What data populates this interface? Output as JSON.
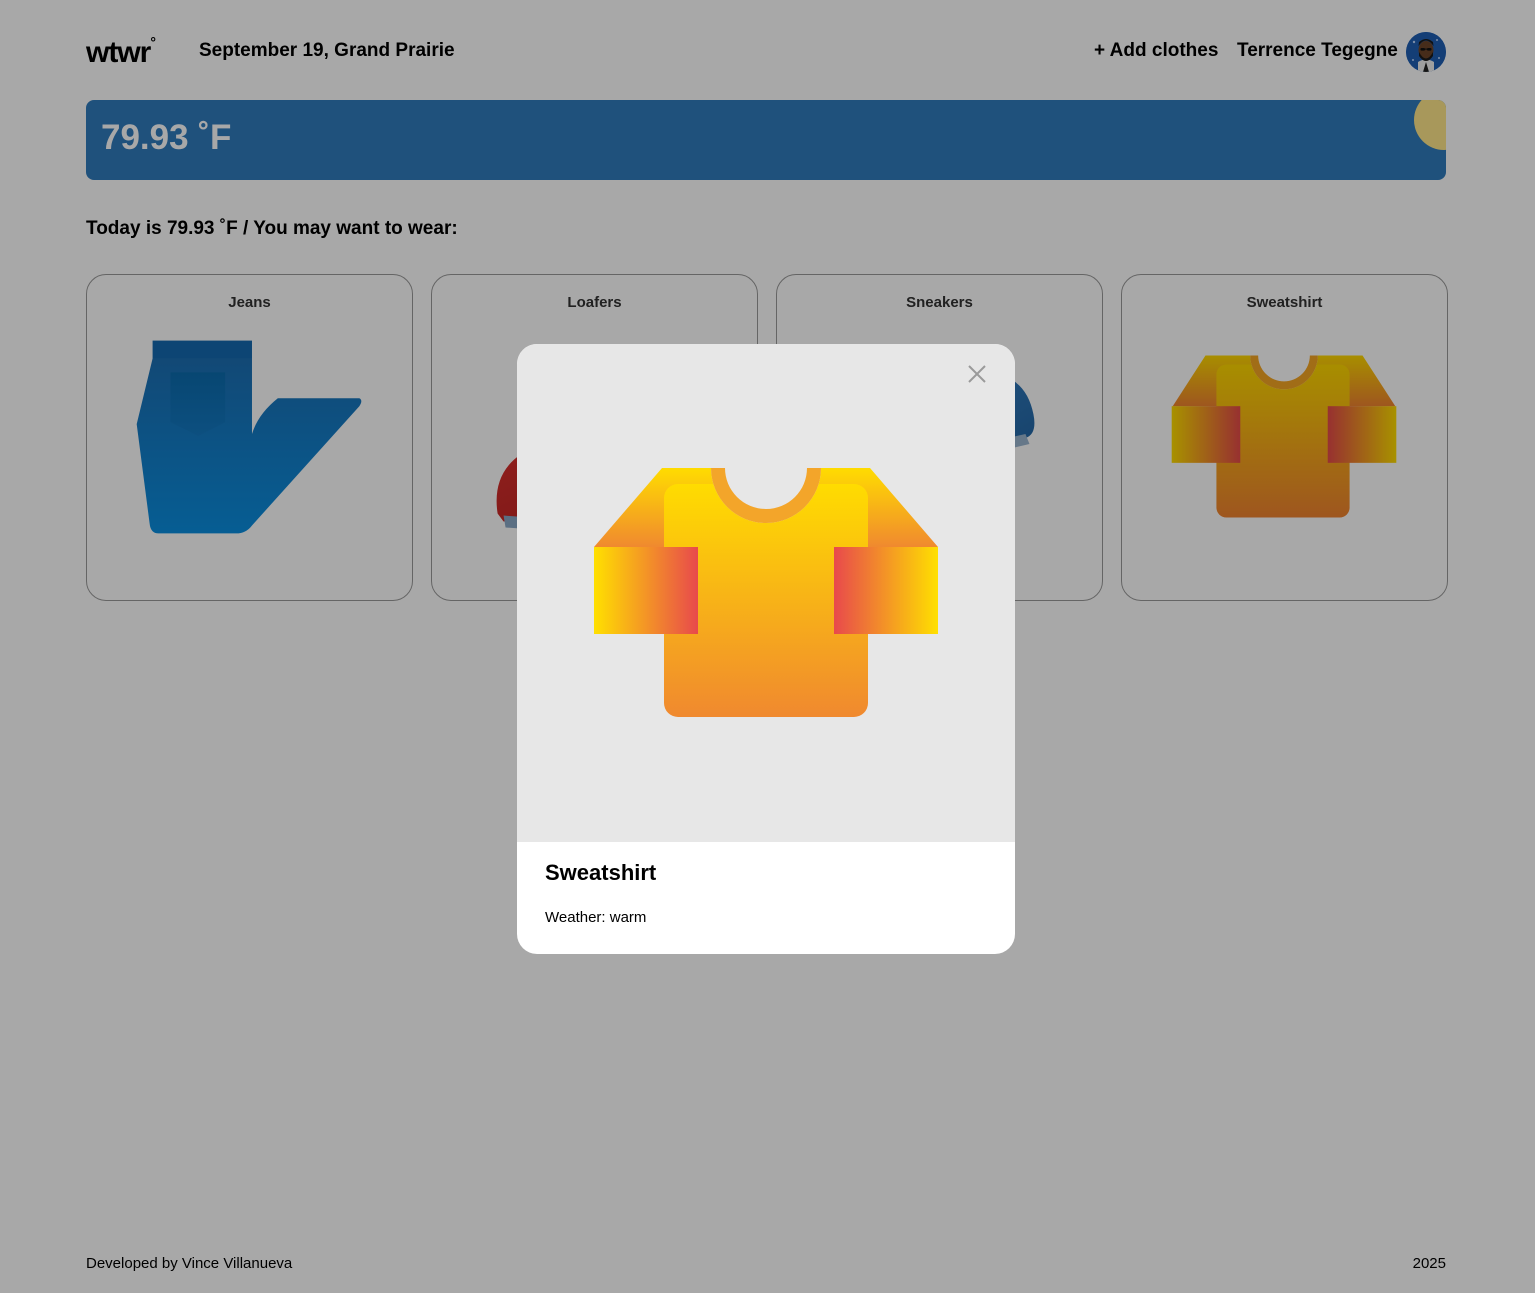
{
  "header": {
    "logo": "wtwr",
    "logo_degree": "°",
    "date_location": "September 19, Grand Prairie",
    "add_clothes_label": "+ Add clothes",
    "username": "Terrence Tegegne"
  },
  "weather": {
    "temperature": "79.93 ˚F",
    "recommendation": "Today is 79.93 ˚F / You may want to wear:"
  },
  "cards": [
    {
      "label": "Jeans"
    },
    {
      "label": "Loafers"
    },
    {
      "label": "Sneakers"
    },
    {
      "label": "Sweatshirt"
    }
  ],
  "modal": {
    "title": "Sweatshirt",
    "weather_text": "Weather: warm"
  },
  "footer": {
    "developer": "Developed by Vince Villanueva",
    "year": "2025"
  },
  "colors": {
    "weather_banner": "#2f7bbd",
    "sun": "#ffe78a",
    "overlay": "rgba(0,0,0,0.34)",
    "modal_image_bg": "#e7e7e7"
  }
}
